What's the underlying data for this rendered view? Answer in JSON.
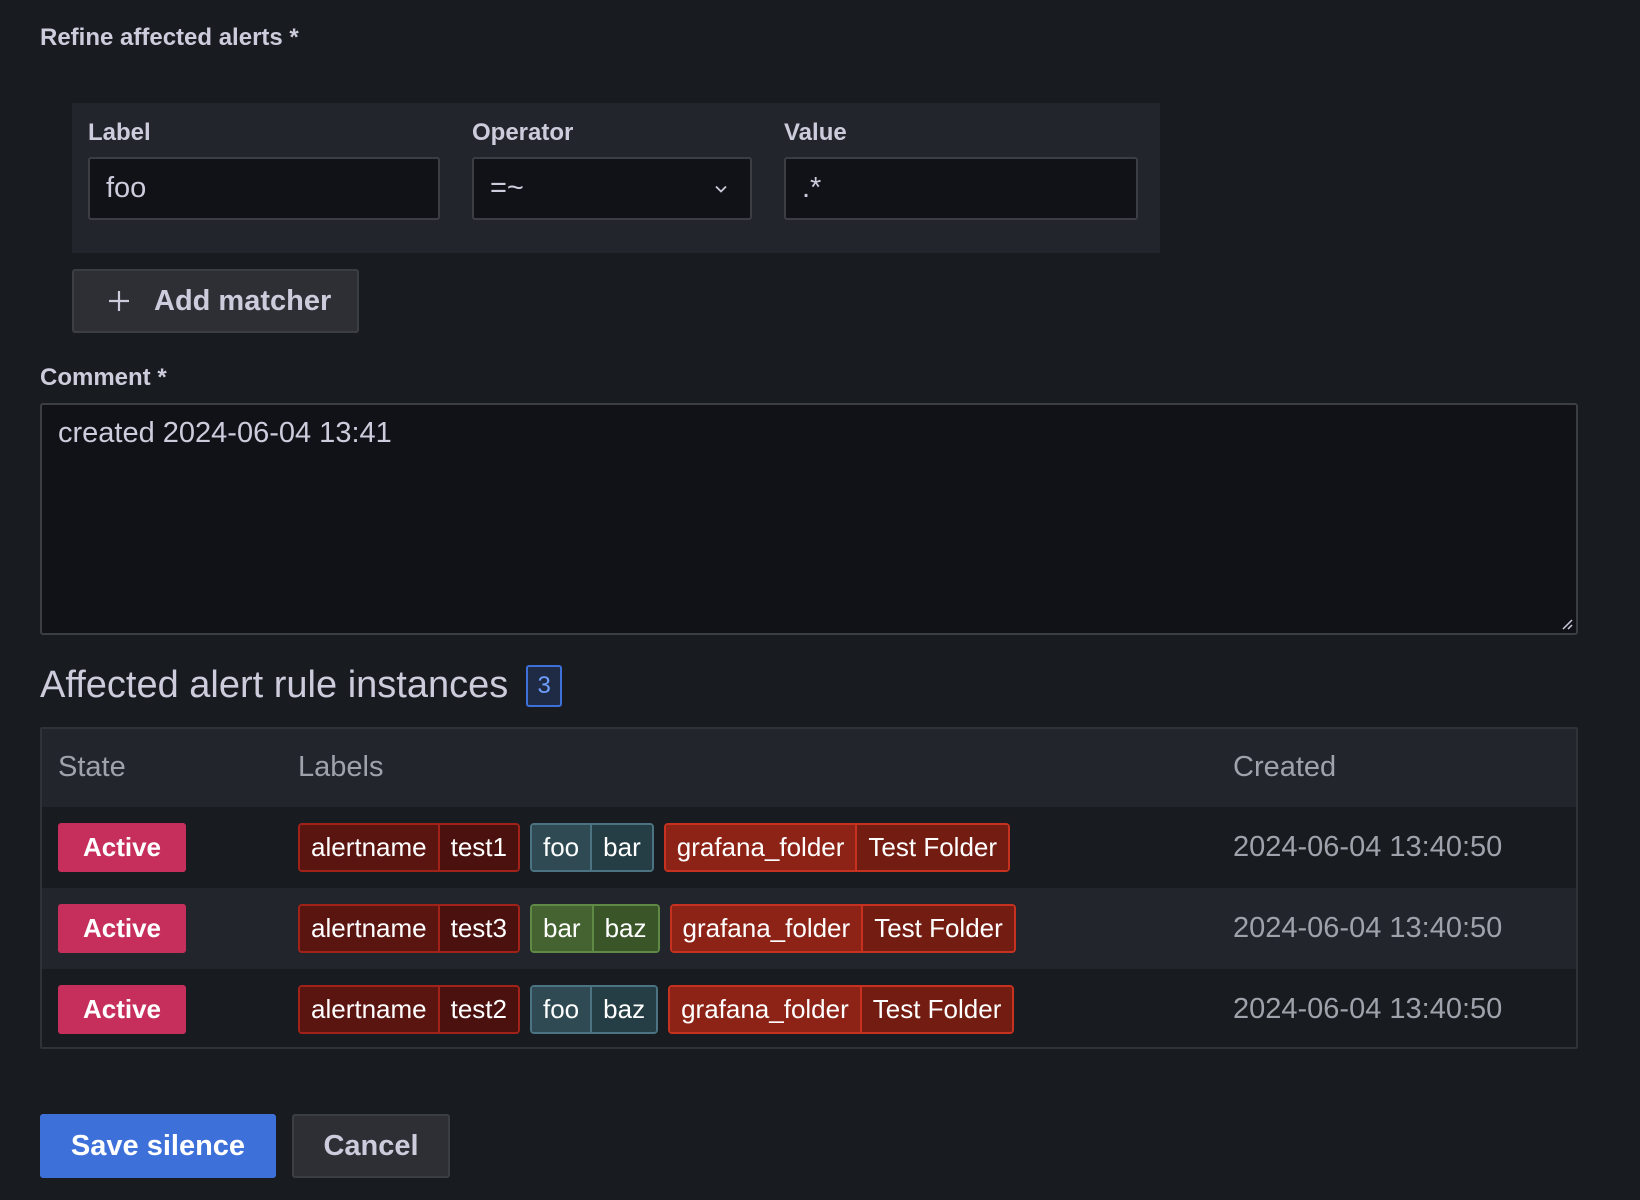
{
  "matchers": {
    "section_label": "Refine affected alerts *",
    "label_header": "Label",
    "operator_header": "Operator",
    "value_header": "Value",
    "label_value": "foo",
    "operator_value": "=~",
    "value_value": ".*",
    "add_button": "Add matcher"
  },
  "comment": {
    "label": "Comment *",
    "value": "created 2024-06-04 13:41"
  },
  "affected": {
    "title": "Affected alert rule instances",
    "count": "3",
    "columns": {
      "state": "State",
      "labels": "Labels",
      "created": "Created"
    },
    "rows": [
      {
        "state": "Active",
        "labels": [
          {
            "key": "alertname",
            "value": "test1"
          },
          {
            "key": "foo",
            "value": "bar"
          },
          {
            "key": "grafana_folder",
            "value": "Test Folder"
          }
        ],
        "created": "2024-06-04 13:40:50"
      },
      {
        "state": "Active",
        "labels": [
          {
            "key": "alertname",
            "value": "test3"
          },
          {
            "key": "bar",
            "value": "baz"
          },
          {
            "key": "grafana_folder",
            "value": "Test Folder"
          }
        ],
        "created": "2024-06-04 13:40:50"
      },
      {
        "state": "Active",
        "labels": [
          {
            "key": "alertname",
            "value": "test2"
          },
          {
            "key": "foo",
            "value": "baz"
          },
          {
            "key": "grafana_folder",
            "value": "Test Folder"
          }
        ],
        "created": "2024-06-04 13:40:50"
      }
    ]
  },
  "actions": {
    "save": "Save silence",
    "cancel": "Cancel"
  },
  "colors": {
    "background": "#181b1f",
    "primary": "#3d71d9",
    "state_active": "#c62f5c"
  },
  "icons": {
    "add": "plus-icon",
    "select": "chevron-down-icon",
    "resize": "resize-handle-icon"
  }
}
